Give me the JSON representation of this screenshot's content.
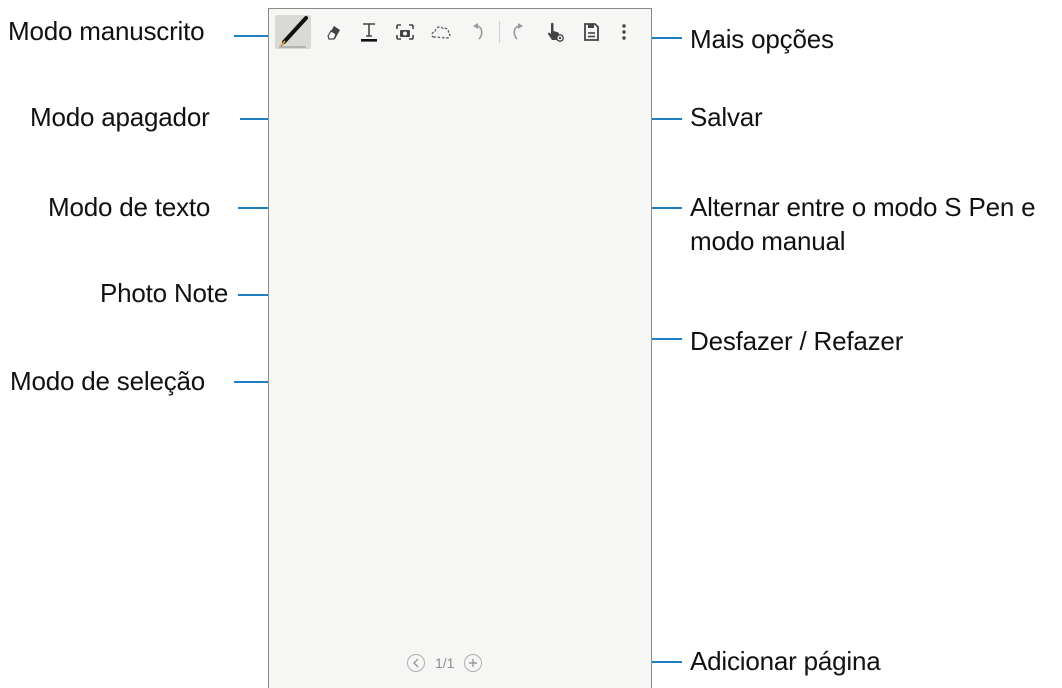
{
  "labels_left": {
    "handwriting": "Modo manuscrito",
    "eraser": "Modo apagador",
    "text": "Modo de texto",
    "photo_note": "Photo Note",
    "selection": "Modo de seleção"
  },
  "labels_right": {
    "more_options": "Mais opções",
    "save": "Salvar",
    "toggle_line1": "Alternar entre o modo S Pen e",
    "toggle_line2": "modo manual",
    "undo_redo": "Desfazer / Refazer",
    "add_page": "Adicionar página"
  },
  "pager": {
    "page_indicator": "1/1",
    "prev_icon": "chevron-left-icon",
    "add_icon": "plus-icon"
  },
  "toolbar": {
    "icons": [
      "pen-icon",
      "eraser-icon",
      "text-icon",
      "camera-icon",
      "lasso-icon",
      "undo-icon",
      "redo-icon",
      "spen-hand-icon",
      "save-icon",
      "more-vertical-icon"
    ]
  },
  "colors": {
    "callout": "#1f7fc4",
    "page_bg": "#f6f6f4",
    "frame": "#8a8a8a",
    "icon": "#444444"
  }
}
